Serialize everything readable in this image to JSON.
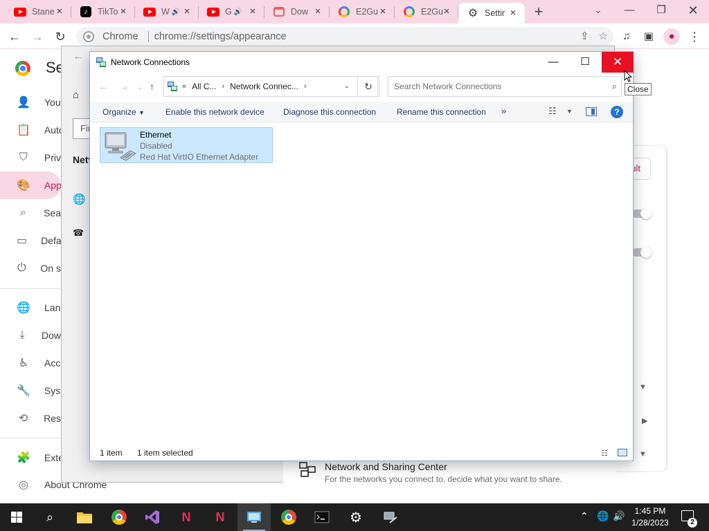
{
  "browser": {
    "tabs": [
      {
        "title": "Stane",
        "icon": "youtube-icon",
        "audio": false
      },
      {
        "title": "TikTo",
        "icon": "tiktok-icon",
        "audio": false
      },
      {
        "title": "W",
        "icon": "youtube-icon",
        "audio": true
      },
      {
        "title": "G",
        "icon": "youtube-icon",
        "audio": true
      },
      {
        "title": "Dow",
        "icon": "download-page-icon",
        "audio": false
      },
      {
        "title": "E2Gu",
        "icon": "google-icon",
        "audio": false
      },
      {
        "title": "E2Gu",
        "icon": "google-icon",
        "audio": false
      },
      {
        "title": "Settir",
        "icon": "gear-icon",
        "audio": false,
        "active": true
      }
    ],
    "new_tab": "+",
    "omnibox": {
      "site": "Chrome",
      "url": "chrome://settings/appearance"
    },
    "accent": "#c2185b",
    "frame_color": "#f8d8e4"
  },
  "settings": {
    "title": "Se",
    "nav": [
      {
        "label": "You",
        "icon": "person-icon"
      },
      {
        "label": "Auto",
        "icon": "clipboard-icon"
      },
      {
        "label": "Priv",
        "icon": "shield-icon"
      },
      {
        "label": "App",
        "icon": "palette-icon",
        "active": true
      },
      {
        "label": "Sea",
        "icon": "search-icon"
      },
      {
        "label": "Defa",
        "icon": "browser-icon"
      },
      {
        "label": "On s",
        "icon": "power-icon"
      },
      {
        "label": "Lan",
        "icon": "globe-icon"
      },
      {
        "label": "Dow",
        "icon": "download-icon"
      },
      {
        "label": "Acc",
        "icon": "accessibility-icon"
      },
      {
        "label": "Syst",
        "icon": "wrench-icon"
      },
      {
        "label": "Res",
        "icon": "history-icon"
      },
      {
        "label": "Exte",
        "icon": "puzzle-icon"
      }
    ],
    "about": "About Chrome",
    "reset_partial": "ult"
  },
  "background_window": {
    "search_partial": "Fir",
    "section_partial": "Netv",
    "nsc_title": "Network and Sharing Center",
    "nsc_desc": "For the networks you connect to, decide what you want to share."
  },
  "network_connections": {
    "title": "Network Connections",
    "address": {
      "prefix": "«",
      "seg1": "All C...",
      "seg2": "Network Connec..."
    },
    "search_placeholder": "Search Network Connections",
    "commands": {
      "organize": "Organize",
      "enable": "Enable this network device",
      "diagnose": "Diagnose this connection",
      "rename": "Rename this connection",
      "more": "»"
    },
    "item": {
      "name": "Ethernet",
      "status": "Disabled",
      "adapter": "Red Hat VirtIO Ethernet Adapter"
    },
    "statusbar": {
      "count": "1 item",
      "selected": "1 item selected"
    },
    "tooltip": "Close"
  },
  "taskbar": {
    "time": "1:45 PM",
    "date": "1/28/2023",
    "notifications": "2"
  }
}
